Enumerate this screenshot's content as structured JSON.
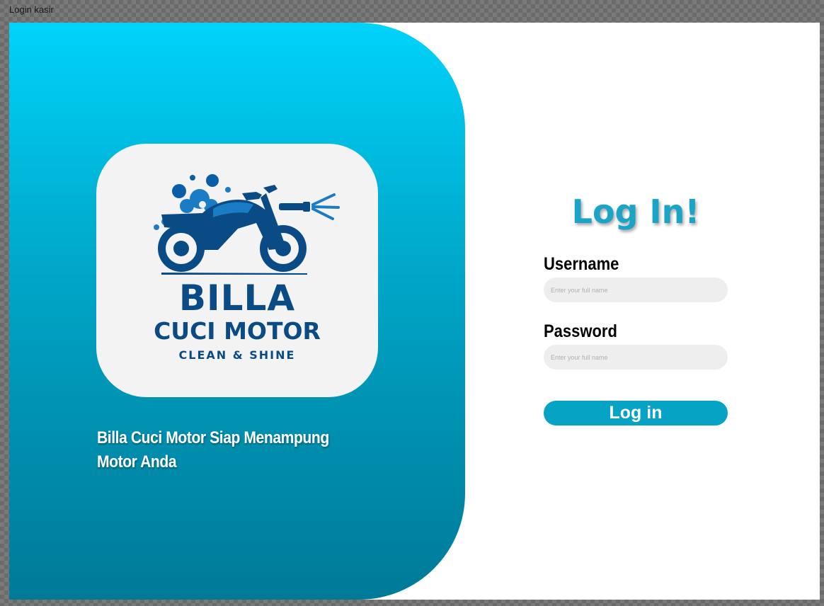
{
  "window": {
    "title": "Login kasir"
  },
  "colors": {
    "panel_gradient_top": "#00d3fb",
    "panel_gradient_bottom": "#007a98",
    "logo_navy": "#0a4b86",
    "title_color": "#1aa5c6",
    "button_color": "#07a3c4",
    "input_bg": "#eeeeee"
  },
  "branding": {
    "logo_icon": "motorcycle-wash-icon",
    "logo_line1": "BILLA",
    "logo_line2": "CUCI MOTOR",
    "logo_line3": "CLEAN & SHINE",
    "tagline": "Billa Cuci Motor Siap Menampung Motor Anda"
  },
  "login": {
    "title": "Log In!",
    "username_label": "Username",
    "username_placeholder": "Enter your full name",
    "username_value": "",
    "password_label": "Password",
    "password_placeholder": "Enter your full name",
    "password_value": "",
    "button_label": "Log in"
  }
}
